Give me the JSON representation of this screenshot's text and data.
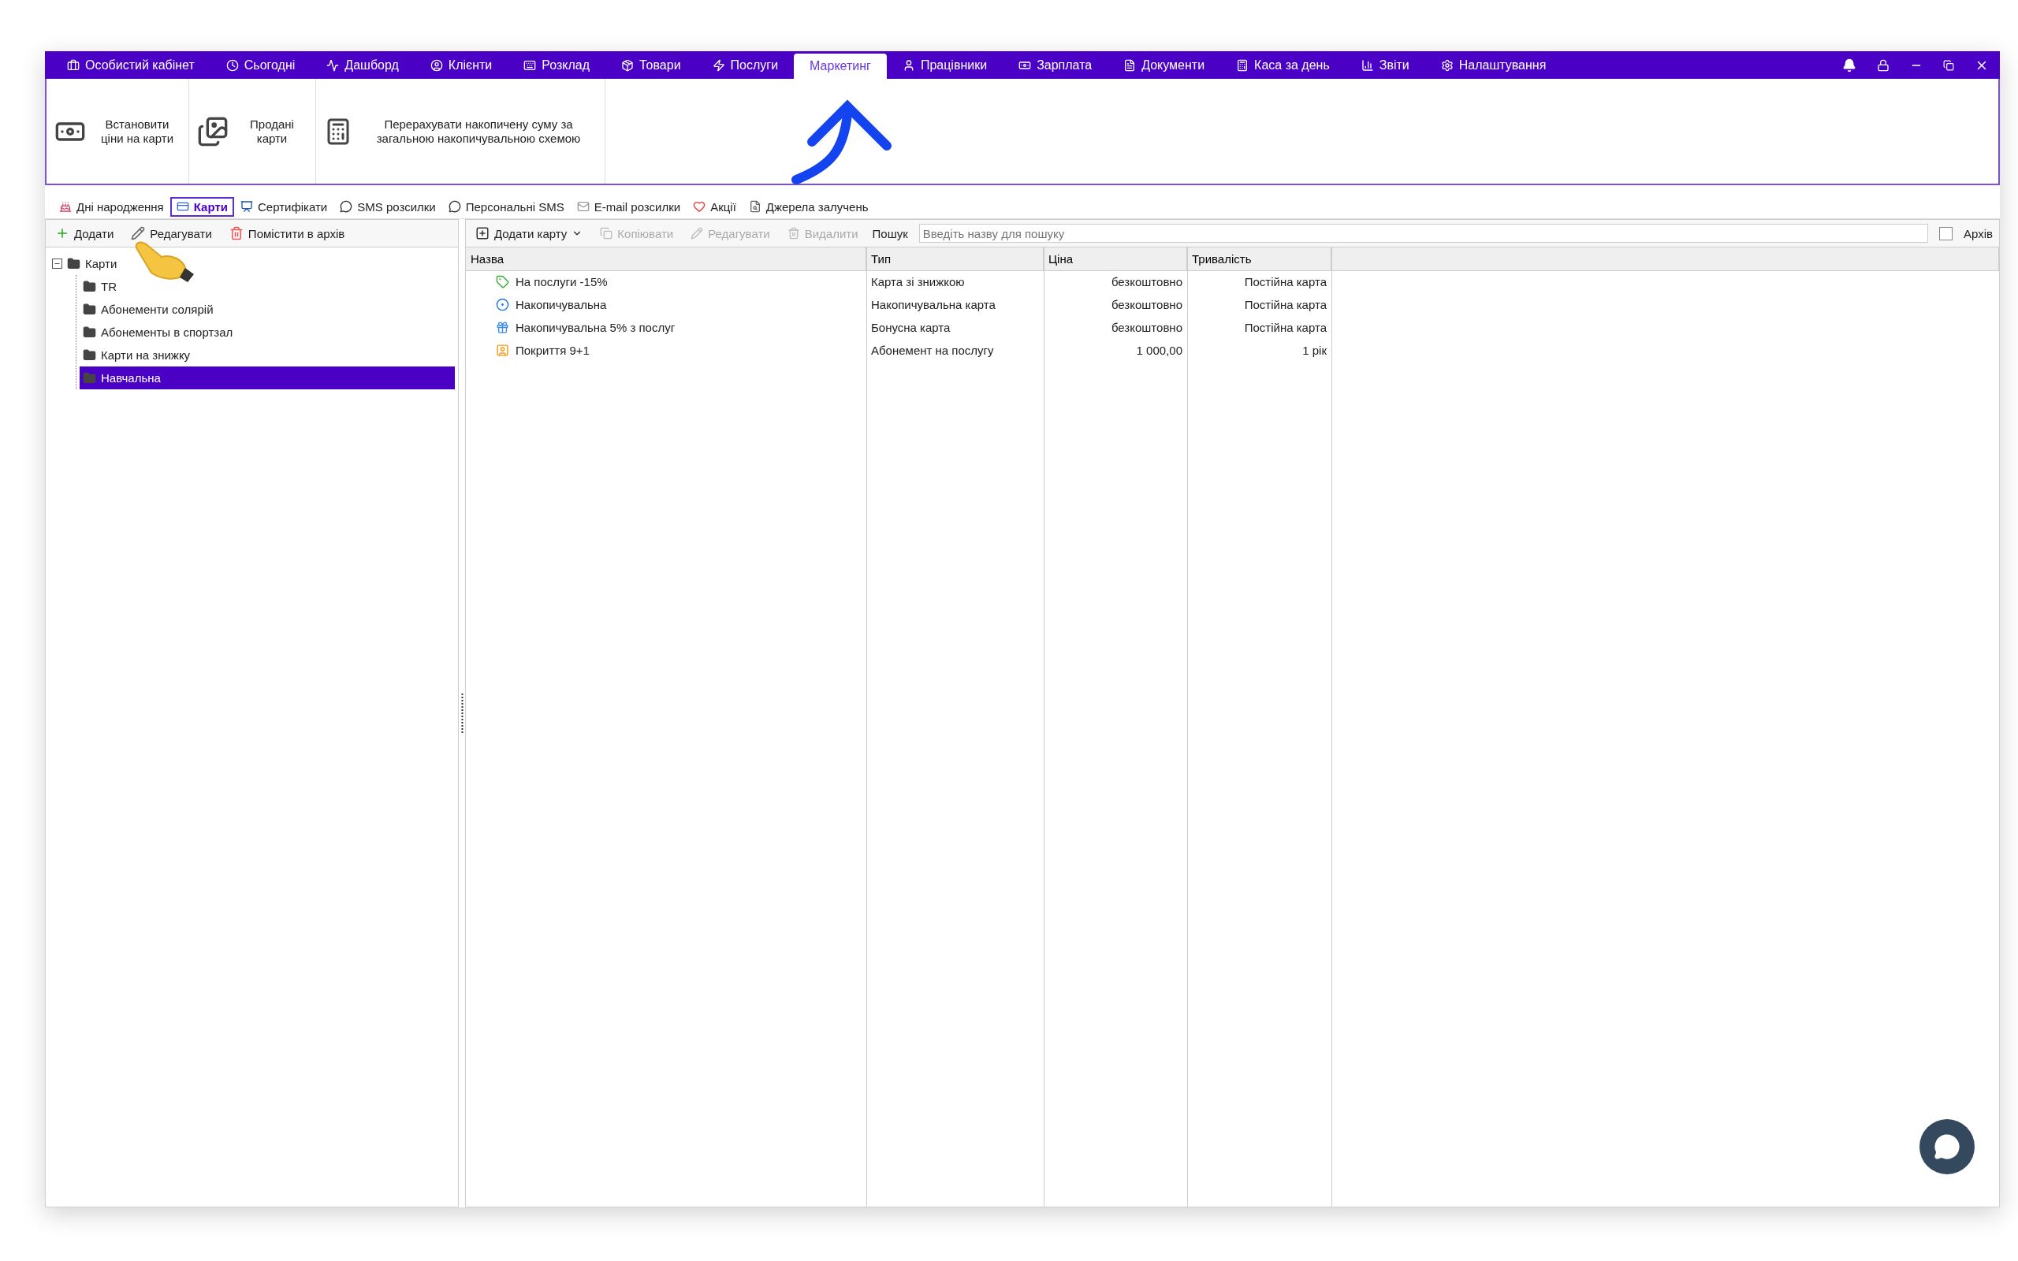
{
  "menu": [
    {
      "label": "Особистий кабінет",
      "selected": false
    },
    {
      "label": "Сьогодні",
      "selected": false
    },
    {
      "label": "Дашборд",
      "selected": false
    },
    {
      "label": "Клієнти",
      "selected": false
    },
    {
      "label": "Розклад",
      "selected": false
    },
    {
      "label": "Товари",
      "selected": false
    },
    {
      "label": "Послуги",
      "selected": false
    },
    {
      "label": "Маркетинг",
      "selected": true
    },
    {
      "label": "Працівники",
      "selected": false
    },
    {
      "label": "Зарплата",
      "selected": false
    },
    {
      "label": "Документи",
      "selected": false
    },
    {
      "label": "Каса за день",
      "selected": false
    },
    {
      "label": "Звіти",
      "selected": false
    },
    {
      "label": "Налаштування",
      "selected": false
    }
  ],
  "ribbon": [
    {
      "label": "Встановити ціни на карти"
    },
    {
      "label": "Продані карти"
    },
    {
      "label": "Перерахувати накопичену суму за загальною накопичувальною схемою"
    }
  ],
  "subtabs": [
    {
      "label": "Дні народження",
      "selected": false
    },
    {
      "label": "Карти",
      "selected": true
    },
    {
      "label": "Сертифікати",
      "selected": false
    },
    {
      "label": "SMS розсилки",
      "selected": false
    },
    {
      "label": "Персональні SMS",
      "selected": false
    },
    {
      "label": "E-mail розсилки",
      "selected": false
    },
    {
      "label": "Акції",
      "selected": false
    },
    {
      "label": "Джерела залучень",
      "selected": false
    }
  ],
  "left_toolbar": [
    "Додати",
    "Редагувати",
    "Помістити в архів"
  ],
  "tree": {
    "label": "Карти",
    "expanded": true,
    "children": [
      {
        "label": "TR",
        "selected": false
      },
      {
        "label": "Абонементи солярій",
        "selected": false
      },
      {
        "label": "Абонементы в спортзал",
        "selected": false
      },
      {
        "label": "Карти на знижку",
        "selected": false
      },
      {
        "label": "Навчальна",
        "selected": true
      }
    ]
  },
  "right_toolbar": {
    "add": "Додати карту",
    "buttons": [
      {
        "label": "Копіювати",
        "disabled": true
      },
      {
        "label": "Редагувати",
        "disabled": true
      },
      {
        "label": "Видалити",
        "disabled": true
      }
    ],
    "search_label": "Пошук",
    "search": {
      "placeholder": "Введіть назву для пошуку"
    },
    "archive": {
      "label": "Архів",
      "checked": false
    }
  },
  "table": {
    "columns": [
      "Назва",
      "Тип",
      "Ціна",
      "Тривалість"
    ],
    "rows": [
      {
        "cells": [
          "На послуги -15%",
          "Карта зі знижкою",
          "безкоштовно",
          "Постійна карта"
        ]
      },
      {
        "cells": [
          "Накопичувальна",
          "Накопичувальна карта",
          "безкоштовно",
          "Постійна карта"
        ]
      },
      {
        "cells": [
          "Накопичувальна 5% з послуг",
          "Бонусна карта",
          "безкоштовно",
          "Постійна карта"
        ]
      },
      {
        "cells": [
          "Покриття 9+1",
          "Абонемент на послугу",
          "1 000,00",
          "1 рік"
        ]
      }
    ]
  }
}
